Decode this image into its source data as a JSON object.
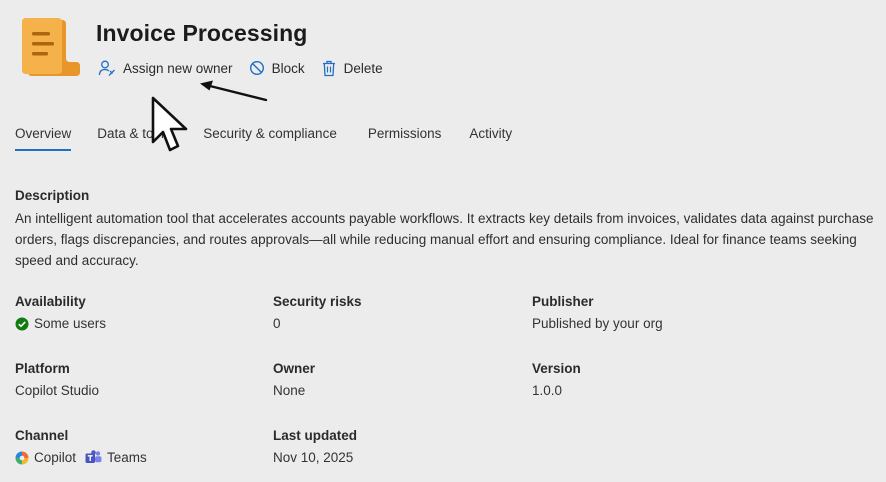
{
  "header": {
    "title": "Invoice Processing",
    "icon": "document-stack-icon",
    "actions": [
      {
        "label": "Assign new owner",
        "icon": "person-edit-icon"
      },
      {
        "label": "Block",
        "icon": "block-icon"
      },
      {
        "label": "Delete",
        "icon": "trash-icon"
      }
    ]
  },
  "tabs": [
    "Overview",
    "Data & tools",
    "Security & compliance",
    "Permissions",
    "Activity"
  ],
  "active_tab": "Overview",
  "description": {
    "label": "Description",
    "text": "An intelligent automation tool that accelerates accounts payable workflows. It extracts key details from invoices, validates data against purchase orders, flags discrepancies, and routes approvals—all while reducing manual effort and ensuring compliance. Ideal for finance teams seeking speed and accuracy."
  },
  "details": {
    "availability": {
      "label": "Availability",
      "value": "Some users"
    },
    "security_risks": {
      "label": "Security risks",
      "value": "0"
    },
    "publisher": {
      "label": "Publisher",
      "value": "Published by your org"
    },
    "platform": {
      "label": "Platform",
      "value": "Copilot Studio"
    },
    "owner": {
      "label": "Owner",
      "value": "None"
    },
    "version": {
      "label": "Version",
      "value": "1.0.0"
    },
    "channel": {
      "label": "Channel",
      "values": [
        "Copilot",
        "Teams"
      ]
    },
    "last_updated": {
      "label": "Last updated",
      "value": "Nov 10, 2025"
    }
  },
  "colors": {
    "accent": "#1f6fc5",
    "success": "#107c10",
    "icon_orange": "#f0a030"
  }
}
